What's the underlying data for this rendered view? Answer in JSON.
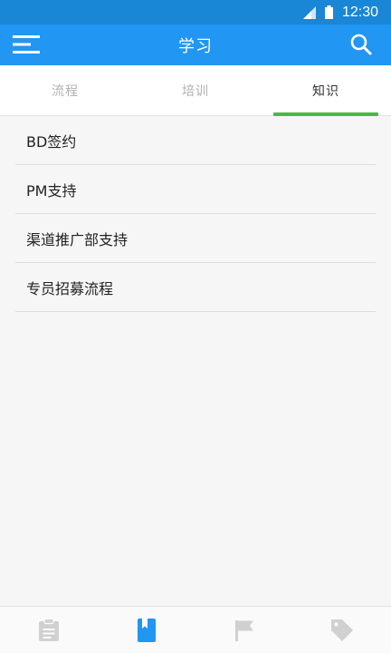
{
  "status_bar": {
    "time": "12:30"
  },
  "app_bar": {
    "title": "学习",
    "menu_icon": "menu-icon",
    "search_icon": "search-icon"
  },
  "tabs": [
    {
      "label": "流程",
      "active": false
    },
    {
      "label": "培训",
      "active": false
    },
    {
      "label": "知识",
      "active": true
    }
  ],
  "list": {
    "items": [
      {
        "label": "BD签约"
      },
      {
        "label": "PM支持"
      },
      {
        "label": "渠道推广部支持"
      },
      {
        "label": "专员招募流程"
      }
    ]
  },
  "bottom_nav": {
    "items": [
      {
        "icon": "clipboard-icon",
        "active": false
      },
      {
        "icon": "book-icon",
        "active": true
      },
      {
        "icon": "flag-icon",
        "active": false
      },
      {
        "icon": "tag-icon",
        "active": false
      }
    ]
  },
  "colors": {
    "status_bar": "#1a86d6",
    "app_bar": "#2196f3",
    "tab_indicator": "#4cb846",
    "nav_active": "#2196f3",
    "nav_inactive": "#d0d0d0"
  }
}
